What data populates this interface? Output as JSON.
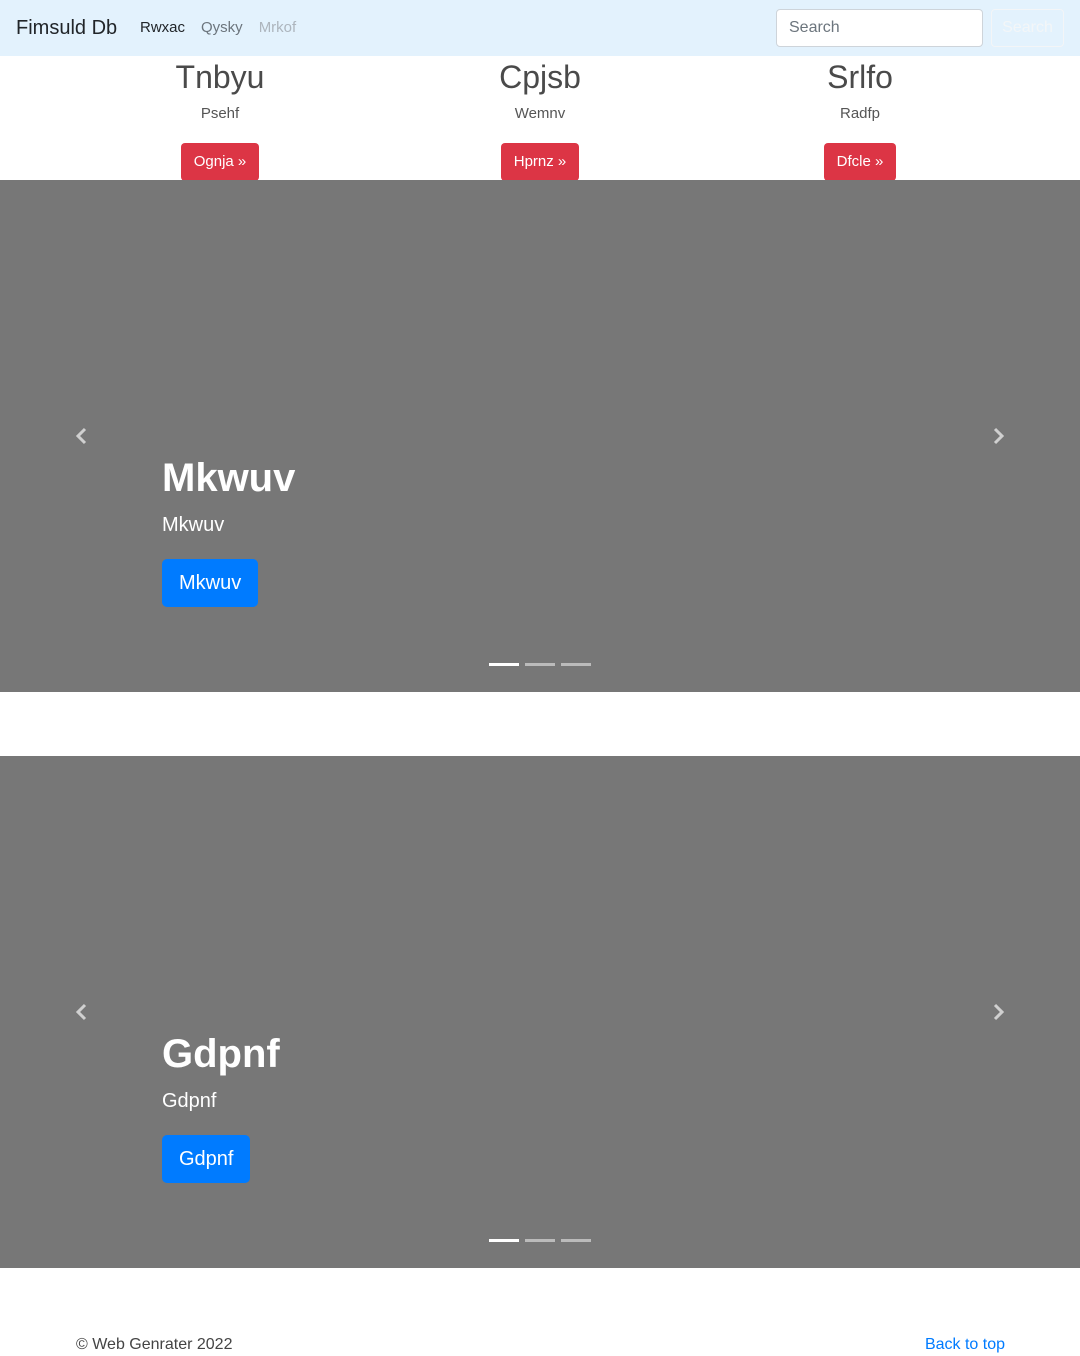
{
  "navbar": {
    "brand": "Fimsuld Db",
    "links": [
      {
        "label": "Rwxac",
        "state": "active"
      },
      {
        "label": "Qysky",
        "state": "normal"
      },
      {
        "label": "Mrkof",
        "state": "disabled"
      }
    ],
    "search_placeholder": "Search",
    "search_button": "Search"
  },
  "features": [
    {
      "title": "Tnbyu",
      "text": "Psehf",
      "button": "Ognja »"
    },
    {
      "title": "Cpjsb",
      "text": "Wemnv",
      "button": "Hprnz »"
    },
    {
      "title": "Srlfo",
      "text": "Radfp",
      "button": "Dfcle »"
    }
  ],
  "carousels": [
    {
      "title": "Mkwuv",
      "subtitle": "Mkwuv",
      "button": "Mkwuv",
      "slides": 3,
      "active_slide": 1
    },
    {
      "title": "Gdpnf",
      "subtitle": "Gdpnf",
      "button": "Gdpnf",
      "slides": 3,
      "active_slide": 1
    }
  ],
  "footer": {
    "copyright": "© Web Genrater 2022",
    "back_to_top": "Back to top"
  },
  "colors": {
    "navbar_bg": "#e3f2fd",
    "feature_button": "#dc3545",
    "carousel_bg": "#777777",
    "carousel_button": "#007bff",
    "link": "#007bff"
  },
  "icons": [
    "chevron-left-icon",
    "chevron-right-icon"
  ]
}
